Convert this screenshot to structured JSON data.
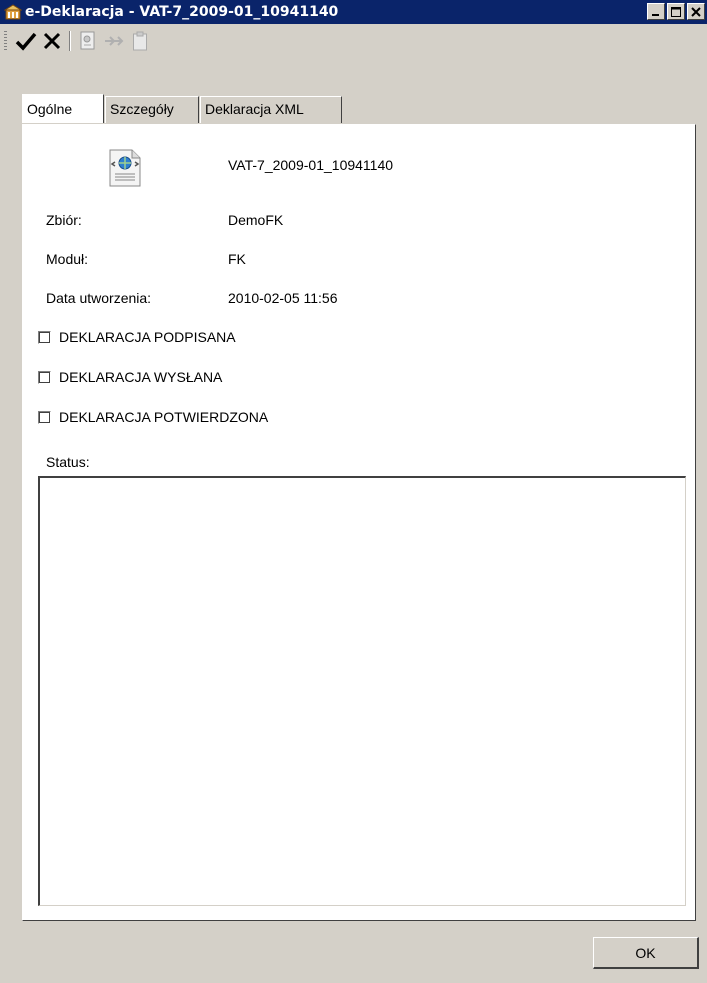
{
  "window": {
    "title": "e-Deklaracja - VAT-7_2009-01_10941140"
  },
  "toolbar": {
    "items": [
      {
        "icon": "check-icon"
      },
      {
        "icon": "cancel-x-icon"
      },
      {
        "icon": "certificate-icon"
      },
      {
        "icon": "send-arrows-icon"
      },
      {
        "icon": "clipboard-icon"
      }
    ]
  },
  "tabs": [
    {
      "label": "Ogólne",
      "active": true
    },
    {
      "label": "Szczegóły",
      "active": false
    },
    {
      "label": "Deklaracja XML",
      "active": false
    }
  ],
  "general": {
    "document_name": "VAT-7_2009-01_10941140",
    "fields": [
      {
        "label": "Zbiór:",
        "value": "DemoFK"
      },
      {
        "label": "Moduł:",
        "value": "FK"
      },
      {
        "label": "Data utworzenia:",
        "value": "2010-02-05 11:56"
      }
    ],
    "checkboxes": [
      {
        "label": "DEKLARACJA PODPISANA",
        "checked": false
      },
      {
        "label": "DEKLARACJA WYSŁANA",
        "checked": false
      },
      {
        "label": "DEKLARACJA POTWIERDZONA",
        "checked": false
      }
    ],
    "status_label": "Status:",
    "status_value": ""
  },
  "footer": {
    "ok_label": "OK"
  }
}
